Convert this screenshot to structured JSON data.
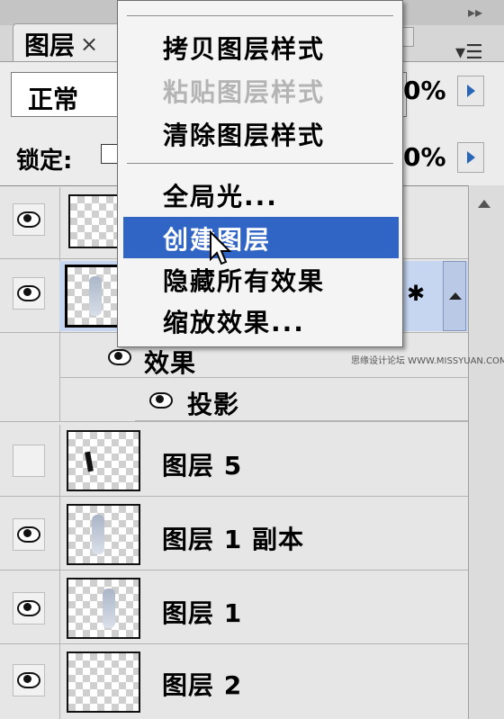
{
  "tab": {
    "label": "图层",
    "close_symbol": "×"
  },
  "blend_mode": {
    "value": "正常",
    "opacity_suffix": "0%"
  },
  "lock": {
    "label": "锁定:",
    "fill_suffix": "0%"
  },
  "context_menu": {
    "items": [
      {
        "label": "拷贝图层样式",
        "state": "normal"
      },
      {
        "label": "粘贴图层样式",
        "state": "disabled"
      },
      {
        "label": "清除图层样式",
        "state": "normal"
      },
      {
        "label": "全局光...",
        "state": "normal"
      },
      {
        "label": "创建图层",
        "state": "highlighted"
      },
      {
        "label": "隐藏所有效果",
        "state": "normal"
      },
      {
        "label": "缩放效果...",
        "state": "normal"
      }
    ]
  },
  "layers": {
    "effects_label": "效果",
    "drop_shadow_label": "投影",
    "rows": [
      {
        "name": "图层 5",
        "visible": false
      },
      {
        "name": "图层 1 副本",
        "visible": true
      },
      {
        "name": "图层 1",
        "visible": true
      },
      {
        "name": "图层 2",
        "visible": true
      }
    ]
  },
  "watermark": "思缘设计论坛 WWW.MISSYUAN.COM",
  "colors": {
    "highlight": "#3165c5",
    "selected_row": "#c6d5f0",
    "panel": "#e6e6e6"
  }
}
